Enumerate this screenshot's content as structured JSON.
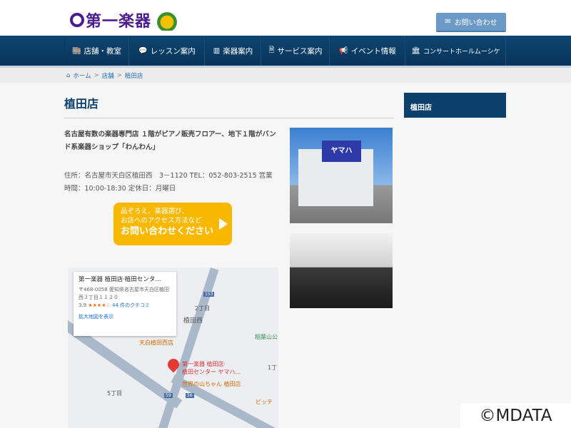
{
  "header": {
    "logo_text": "第一楽器",
    "contact_label": "お問い合わせ",
    "contact_icon": "envelope-icon"
  },
  "nav": [
    {
      "label": "店舗・教室",
      "icon": "store-icon",
      "glyph": "🏬"
    },
    {
      "label": "レッスン案内",
      "icon": "chat-icon",
      "glyph": "💬"
    },
    {
      "label": "楽器案内",
      "icon": "piano-icon",
      "glyph": "▥"
    },
    {
      "label": "サービス案内",
      "icon": "document-icon",
      "glyph": "🗎"
    },
    {
      "label": "イベント情報",
      "icon": "megaphone-icon",
      "glyph": "📢"
    },
    {
      "label": "コンサートホールムーシケ",
      "icon": "bank-icon",
      "glyph": "🏛"
    }
  ],
  "breadcrumb": {
    "home": "ホーム",
    "sep": ">",
    "items": [
      "店舗",
      "植田店"
    ]
  },
  "main": {
    "title": "植田店",
    "description": "名古屋有数の楽器専門店 １階がピアノ販売フロアー、地下１階がバンド系楽器ショップ「わんわん」",
    "address": "住所：名古屋市天白区植田西　3－1120 TEL：052-803-2515 営業時間：10:00-18:30 定休日：月曜日",
    "cta": {
      "line1": "品ぞろえ、楽器選び、",
      "line2": "お店へのアクセス方法など",
      "line3": "お問い合わせください"
    }
  },
  "map": {
    "card_name": "第一楽器 植田店·植田センタ...",
    "card_address": "〒468-0058 愛知県名古屋市天白区植田西３丁目１１２０",
    "rating": "3.9",
    "stars": "★★★★☆",
    "reviews": "44 件のクチコミ",
    "enlarge": "拡大地図を表示",
    "pin_label1": "第一楽器 植田店·",
    "pin_label2": "植田センター ヤマハ...",
    "labels": [
      "2丁目",
      "植田西",
      "天白植田西店",
      "稲葉山公",
      "世界の山ちゃん 植田店",
      "5丁目",
      "1丁",
      "153",
      "59",
      "56",
      "ピッテ"
    ]
  },
  "photo_sign": "ヤマハ",
  "sidebar": {
    "title": "植田店"
  },
  "watermark": "©MDATA",
  "colors": {
    "nav": "#0b3f6c",
    "cta": "#f9b800",
    "logo": "#4b1d8c"
  }
}
